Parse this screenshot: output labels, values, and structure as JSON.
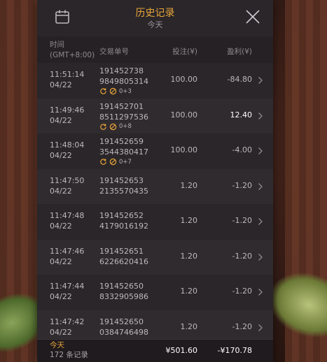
{
  "header": {
    "title": "历史记录",
    "subtitle": "今天",
    "calendar_icon": "calendar-icon",
    "close_icon": "close-icon"
  },
  "columns": {
    "time_line1": "时间",
    "time_line2": "(GMT+8:00)",
    "order": "交易单号",
    "bet": "投注(¥)",
    "profit": "盈利(¥)"
  },
  "rows": [
    {
      "time": "11:51:14",
      "date": "04/22",
      "order1": "191452738",
      "order2": "9849805314",
      "extra": "0+3",
      "bet": "100.00",
      "profit": "-84.80",
      "profit_positive": false
    },
    {
      "time": "11:49:46",
      "date": "04/22",
      "order1": "191452701",
      "order2": "8511297536",
      "extra": "0+8",
      "bet": "100.00",
      "profit": "12.40",
      "profit_positive": true
    },
    {
      "time": "11:48:04",
      "date": "04/22",
      "order1": "191452659",
      "order2": "3544380417",
      "extra": "0+7",
      "bet": "100.00",
      "profit": "-4.00",
      "profit_positive": false
    },
    {
      "time": "11:47:50",
      "date": "04/22",
      "order1": "191452653",
      "order2": "2135570435",
      "extra": "",
      "bet": "1.20",
      "profit": "-1.20",
      "profit_positive": false
    },
    {
      "time": "11:47:48",
      "date": "04/22",
      "order1": "191452652",
      "order2": "4179016192",
      "extra": "",
      "bet": "1.20",
      "profit": "-1.20",
      "profit_positive": false
    },
    {
      "time": "11:47:46",
      "date": "04/22",
      "order1": "191452651",
      "order2": "6226620416",
      "extra": "",
      "bet": "1.20",
      "profit": "-1.20",
      "profit_positive": false
    },
    {
      "time": "11:47:44",
      "date": "04/22",
      "order1": "191452650",
      "order2": "8332905986",
      "extra": "",
      "bet": "1.20",
      "profit": "-1.20",
      "profit_positive": false
    },
    {
      "time": "11:47:42",
      "date": "04/22",
      "order1": "191452650",
      "order2": "0384746498",
      "extra": "",
      "bet": "1.20",
      "profit": "-1.20",
      "profit_positive": false
    }
  ],
  "footer": {
    "label": "今天",
    "count": "172 条记录",
    "total_bet": "¥501.60",
    "total_profit": "-¥170.78"
  },
  "colors": {
    "accent": "#e8a53a",
    "panel": "#2a2629",
    "row_alt": "#302b2f"
  }
}
